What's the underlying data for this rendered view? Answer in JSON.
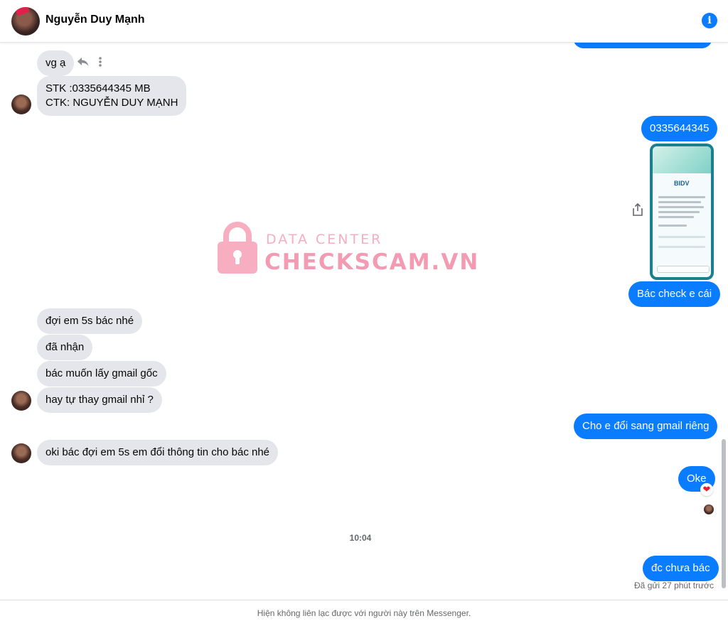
{
  "header": {
    "contact_name": "Nguyễn Duy Mạnh",
    "info_icon": "i"
  },
  "messages": {
    "in_1": "vg ạ",
    "in_2_line1": "STK :0335644345 MB",
    "in_2_line2": "CTK: NGUYỄN DUY MẠNH",
    "out_1": "0335644345",
    "out_2": "Bác check e cái",
    "in_3": "đợi em 5s bác nhé",
    "in_4": "đã nhận",
    "in_5": "bác muốn lấy gmail gốc",
    "in_6": "hay tự thay gmail nhỉ ?",
    "out_3": "Cho e đổi sang gmail riêng",
    "in_7": "oki bác đợi em 5s em đổi thông tin cho bác nhé",
    "out_4": "Oke",
    "out_4_reaction": "❤",
    "timestamp": "10:04",
    "out_5": "đc chưa bác",
    "sent_status": "Đã gửi 27 phút trước"
  },
  "attachment": {
    "bank_logo": "BIDV"
  },
  "watermark": {
    "line1": "DATA CENTER",
    "line2": "CHECKSCAM.VN"
  },
  "footer": {
    "notice": "Hiện không liên lạc được với người này trên Messenger."
  },
  "colors": {
    "outgoing_bubble": "#0a7cff",
    "incoming_bubble": "#e4e6eb",
    "watermark": "#f39bb3"
  },
  "icons": [
    "info-icon",
    "reply-icon",
    "more-icon",
    "share-icon",
    "heart-icon",
    "lock-icon"
  ]
}
